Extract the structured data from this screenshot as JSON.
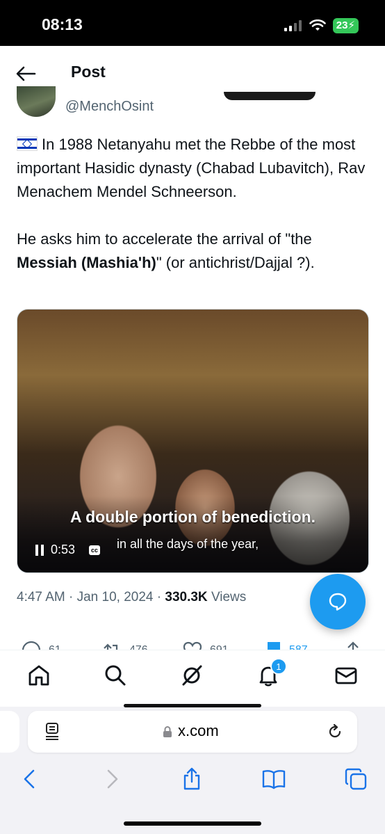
{
  "status_bar": {
    "time": "08:13",
    "battery": "23"
  },
  "nav": {
    "title": "Post"
  },
  "author": {
    "handle": "@MenchOsint"
  },
  "tweet": {
    "para1": "In 1988 Netanyahu met the Rebbe of the most important Hasidic dynasty (Chabad Lubavitch), Rav Menachem Mendel Schneerson.",
    "para2_prefix": "He asks him to accelerate the arrival of \"the ",
    "para2_bold": "Messiah (Mashia'h)",
    "para2_suffix": "\" (or antichrist/Dajjal ?)."
  },
  "video": {
    "subtitle_main": "A double portion of benediction.",
    "subtitle_next": "in all the days of the year,",
    "time": "0:53",
    "cc": "cc"
  },
  "meta": {
    "time": "4:47 AM",
    "sep1": "·",
    "date": "Jan 10, 2024",
    "sep2": "·",
    "views_count": "330.3K",
    "views_label": "Views"
  },
  "actions": {
    "replies": "61",
    "reposts": "476",
    "likes": "691",
    "bookmarks": "587"
  },
  "tabbar": {
    "notifications_badge": "1"
  },
  "safari": {
    "url": "x.com"
  },
  "colors": {
    "accent": "#1d9bf0",
    "text": "#0f1419",
    "secondary": "#536471",
    "battery": "#34c759"
  }
}
